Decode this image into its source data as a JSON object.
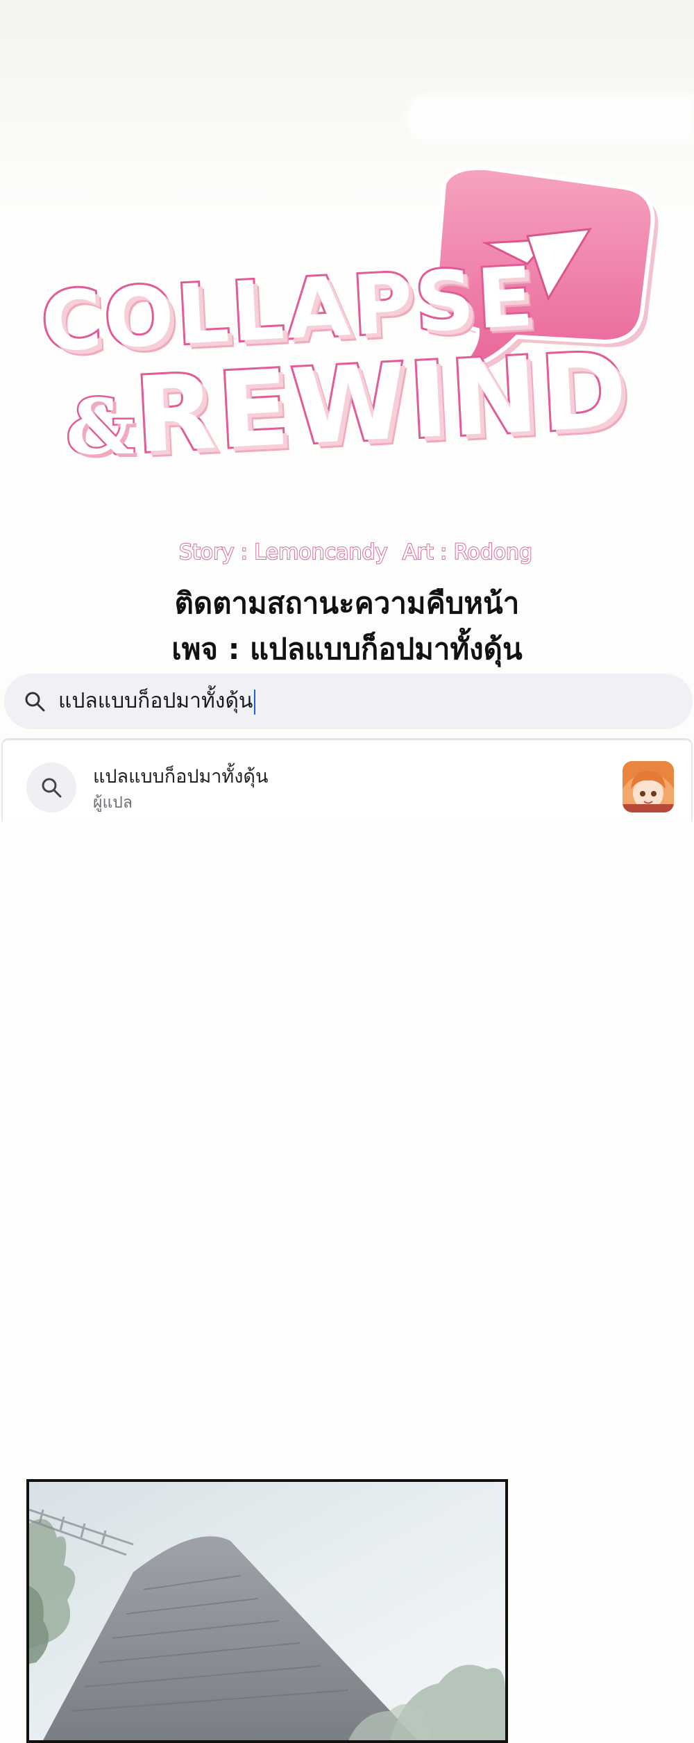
{
  "title_art": {
    "line1": "COLLAPSE",
    "ampersand": "&",
    "line2": "REWIND",
    "story_credit": "Story : Lemoncandy",
    "art_credit": "Art : Rodong"
  },
  "notice": {
    "line1": "ติดตามสถานะความคืบหน้า",
    "line2": "เพจ : แปลแบบก็อปมาทั้งดุ้น"
  },
  "search": {
    "query": "แปลแบบก็อปมาทั้งดุ้น",
    "icon": "search-icon"
  },
  "suggestion": {
    "name": "แปลแบบก็อปมาทั้งดุ้น",
    "subtitle": "ผู้แปล",
    "icon": "search-icon",
    "avatar": "profile-avatar"
  },
  "colors": {
    "title_stroke": "#e25b97",
    "title_shadow": "#f1a9bf",
    "bubble_pink": "#ef7fa6",
    "search_bg": "#eff1f5",
    "caret": "#1d5ed8"
  }
}
